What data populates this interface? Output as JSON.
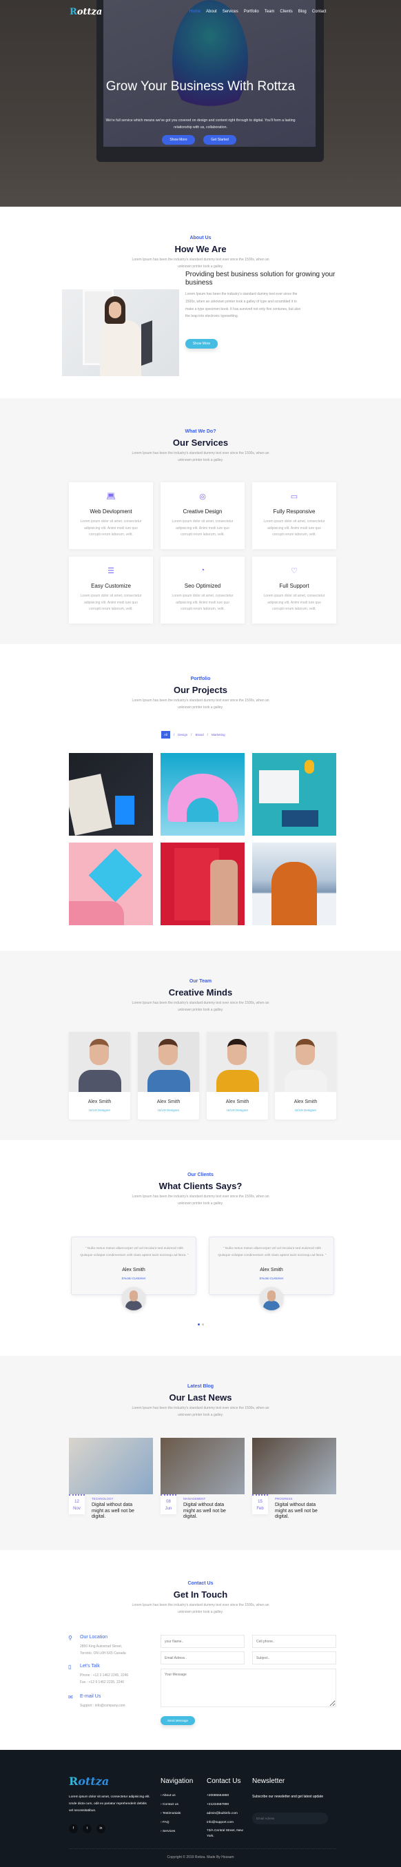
{
  "nav": {
    "logo": "Rottza",
    "links": [
      "Home",
      "About",
      "Services",
      "Portfolio",
      "Team",
      "Clients",
      "Blog",
      "Contact"
    ]
  },
  "hero": {
    "title": "Grow Your Business With Rottza",
    "text": "We're full service which means we've got you covered on design and content right through to digital. You'll form a lasting relationship with us, collaboration.",
    "buttons": [
      "Show More",
      "Get Started"
    ]
  },
  "section_desc": "Lorem Ipsum has been the industry's standard dummy text ever since the 1500s, when an unknown printer took a galley.",
  "about": {
    "subtitle": "About Us",
    "title": "How We Are",
    "heading": "Providing best business solution for growing your business",
    "text": "Lorem Ipsum has been the industry's standard dummy text ever since the 1500s, when an unknown printer took a galley of type and scrambled it to make a type specimen book. It has survived not only five centuries, but also the leap into electronic typesetting.",
    "button": "Show More"
  },
  "services": {
    "subtitle": "What We Do?",
    "title": "Our Services",
    "items": [
      {
        "icon": "laptop-icon",
        "name": "Web Devlopment",
        "text": "Lorem ipsum dolor sit amet, consectetur adipisicing elit. Animi modi iure quo corrupti rerum laborum, velit."
      },
      {
        "icon": "palette-icon",
        "name": "Creative Design",
        "text": "Lorem ipsum dolor sit amet, consectetur adipisicing elit. Animi modi iure quo corrupti rerum laborum, velit."
      },
      {
        "icon": "devices-icon",
        "name": "Fully Responsive",
        "text": "Lorem ipsum dolor sit amet, consectetur adipisicing elit. Animi modi iure quo corrupti rerum laborum, velit."
      },
      {
        "icon": "server-icon",
        "name": "Easy Customize",
        "text": "Lorem ipsum dolor sit amet, consectetur adipisicing elit. Animi modi iure quo corrupti rerum laborum, velit."
      },
      {
        "icon": "chart-pie-icon",
        "name": "Seo Optimized",
        "text": "Lorem ipsum dolor sit amet, consectetur adipisicing elit. Animi modi iure quo corrupti rerum laborum, velit."
      },
      {
        "icon": "heart-pulse-icon",
        "name": "Full Support",
        "text": "Lorem ipsum dolor sit amet, consectetur adipisicing elit. Animi modi iure quo corrupti rerum laborum, velit."
      }
    ]
  },
  "portfolio": {
    "subtitle": "Portfolio",
    "title": "Our Projects",
    "filters": [
      "All",
      "Design",
      "Brand",
      "Marketing"
    ],
    "active_filter": "All"
  },
  "team": {
    "subtitle": "Our Team",
    "title": "Creative Minds",
    "members": [
      {
        "name": "Alex Smith",
        "role": "UI/UX Designer"
      },
      {
        "name": "Alex Smith",
        "role": "UI/UX Designer"
      },
      {
        "name": "Alex Smith",
        "role": "UI/UX Designer"
      },
      {
        "name": "Alex Smith",
        "role": "UI/UX Designer"
      }
    ]
  },
  "clients": {
    "subtitle": "Our Clients",
    "title": "What Clients Says?",
    "testimonials": [
      {
        "quote": "\" Nulla metus metus ullamcorper vel vel tincidunt sed euismod nibh Quisque volutpat condimentum velit class aptent taciti sociosqu ad litora. \"",
        "name": "Alex Smith",
        "role": "Envato Customer"
      },
      {
        "quote": "\" Nulla metus metus ullamcorper vel vel tincidunt sed euismod nibh Quisque volutpat condimentum velit class aptent taciti sociosqu ad litora. \"",
        "name": "Alex Smith",
        "role": "Envato Customer"
      }
    ]
  },
  "blog": {
    "subtitle": "Latest Blog",
    "title": "Our Last News",
    "posts": [
      {
        "day": "12",
        "month": "Nov",
        "category": "TECHNOLOGY",
        "title": "Digital without data might as well not be digital."
      },
      {
        "day": "08",
        "month": "Jun",
        "category": "MANAGEMENT",
        "title": "Digital without data might as well not be digital."
      },
      {
        "day": "15",
        "month": "Feb",
        "category": "PROGRESS",
        "title": "Digital without data might as well not be digital."
      }
    ]
  },
  "contact": {
    "subtitle": "Contact Us",
    "title": "Get In Touch",
    "info": [
      {
        "icon": "map-pin-icon",
        "title": "Our Location",
        "lines": [
          "2850 King Autostrad Street,",
          "Toronto, ON L6H 6X5 Canada"
        ]
      },
      {
        "icon": "phone-icon",
        "title": "Let's Talk",
        "lines": [
          "Phone : +12 3 1462 2245, 2246",
          "Fax : +12 9 1462 2235, 2246"
        ]
      },
      {
        "icon": "mail-icon",
        "title": "E-mail Us",
        "lines": [
          "Support : info@company.com"
        ]
      }
    ],
    "form": {
      "name": "your Name..",
      "phone": "Cell phone..",
      "email": "Email Adress..",
      "subject": "Subject..",
      "message": "Your Message",
      "button": "Send Message"
    }
  },
  "footer": {
    "logo": "Rottza",
    "about": "Lorem ipsum dolor sit amet, consectetur adipisicing elit. Unde dicta cum, odit ex pariatur reprehenderit debitis vel necessitatibus.",
    "social": [
      "facebook-icon",
      "twitter-icon",
      "linkedin-icon"
    ],
    "nav_title": "Navigation",
    "nav_links": [
      "About us",
      "Contact us",
      "Testimonials",
      "FAQ",
      "Services"
    ],
    "contact_title": "Contact Us",
    "contact_lines": [
      "+20085564860",
      "+21234567890",
      "admin@builtinfo.com",
      "info@support.com",
      "73/A Central Street, New York."
    ],
    "newsletter_title": "Newsletter",
    "newsletter_text": "Subscribe our newsletter and get latest update",
    "newsletter_placeholder": "Email Adress",
    "copyright": "Copyright © 2019 Rottza. Made By Hossam"
  },
  "colors": {
    "primary": "#3b63e6",
    "accent": "#42b6dc",
    "dark": "#141833",
    "footer": "#121921"
  }
}
